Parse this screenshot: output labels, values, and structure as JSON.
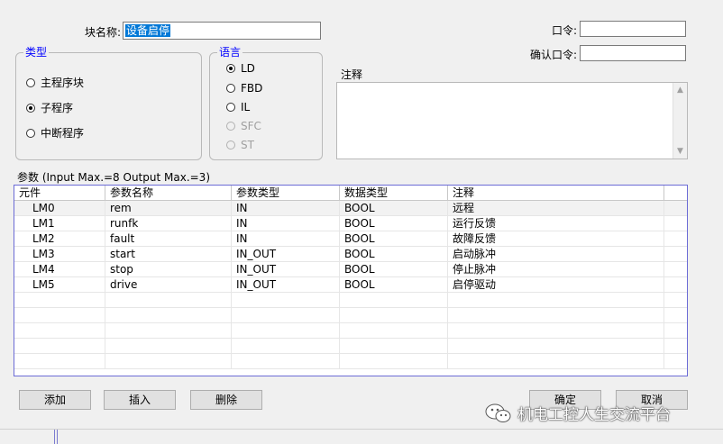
{
  "header": {
    "block_name_label": "块名称:",
    "block_name_value": "设备启停",
    "password_label": "口令:",
    "password_value": "",
    "confirm_password_label": "确认口令:",
    "confirm_password_value": ""
  },
  "type_group": {
    "title": "类型",
    "options": [
      "主程序块",
      "子程序",
      "中断程序"
    ],
    "selected": "子程序"
  },
  "language_group": {
    "title": "语言",
    "options": [
      "LD",
      "FBD",
      "IL",
      "SFC",
      "ST"
    ],
    "selected": "LD",
    "disabled": [
      "SFC",
      "ST"
    ]
  },
  "comment": {
    "label": "注释",
    "value": ""
  },
  "params": {
    "caption": "参数 (Input Max.=8  Output Max.=3)",
    "columns": [
      "元件",
      "参数名称",
      "参数类型",
      "数据类型",
      "注释"
    ],
    "rows": [
      [
        "LM0",
        "rem",
        "IN",
        "BOOL",
        "远程"
      ],
      [
        "LM1",
        "runfk",
        "IN",
        "BOOL",
        "运行反馈"
      ],
      [
        "LM2",
        "fault",
        "IN",
        "BOOL",
        "故障反馈"
      ],
      [
        "LM3",
        "start",
        "IN_OUT",
        "BOOL",
        "启动脉冲"
      ],
      [
        "LM4",
        "stop",
        "IN_OUT",
        "BOOL",
        "停止脉冲"
      ],
      [
        "LM5",
        "drive",
        "IN_OUT",
        "BOOL",
        "启停驱动"
      ]
    ]
  },
  "buttons": {
    "add": "添加",
    "insert": "插入",
    "delete": "删除",
    "ok": "确定",
    "cancel": "取消"
  },
  "watermark": {
    "text": "机电工控人生交流平台",
    "icon": "wechat-icon"
  }
}
